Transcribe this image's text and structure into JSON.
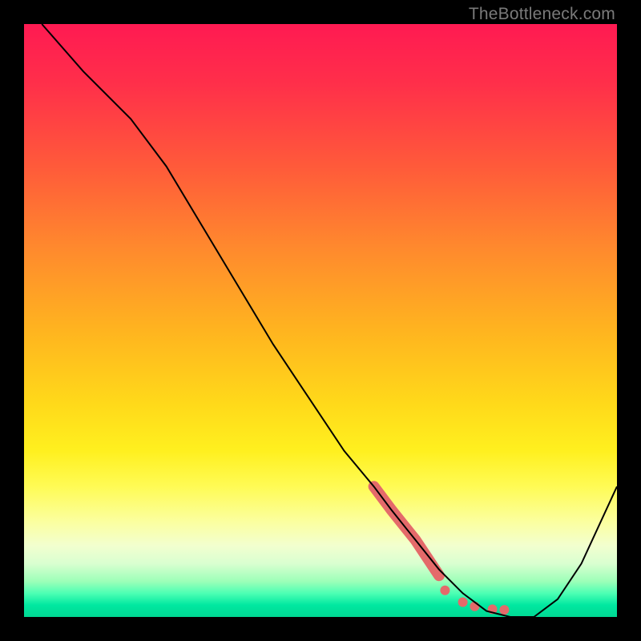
{
  "watermark": "TheBottleneck.com",
  "chart_data": {
    "type": "line",
    "title": "",
    "xlabel": "",
    "ylabel": "",
    "xlim": [
      0,
      100
    ],
    "ylim": [
      0,
      100
    ],
    "grid": false,
    "legend": false,
    "series": [
      {
        "name": "bottleneck-curve",
        "x": [
          3,
          10,
          18,
          24,
          30,
          36,
          42,
          48,
          54,
          59,
          62,
          66,
          70,
          74,
          78,
          82,
          86,
          90,
          94,
          100
        ],
        "y": [
          100,
          92,
          84,
          76,
          66,
          56,
          46,
          37,
          28,
          22,
          18,
          13,
          8,
          4,
          1,
          0,
          0,
          3,
          9,
          22
        ],
        "stroke": "#000000",
        "stroke_width": 2
      }
    ],
    "highlight_segment": {
      "name": "optimal-zone",
      "color": "#e46a6a",
      "thick_width": 14,
      "x": [
        59,
        62,
        66,
        70
      ],
      "y": [
        22,
        18,
        13,
        7
      ]
    },
    "highlight_dots": {
      "name": "optimal-dots",
      "color": "#e46a6a",
      "radius": 6,
      "points": [
        {
          "x": 71,
          "y": 4.5
        },
        {
          "x": 74,
          "y": 2.5
        },
        {
          "x": 76,
          "y": 1.8
        },
        {
          "x": 79,
          "y": 1.3
        },
        {
          "x": 81,
          "y": 1.2
        }
      ]
    }
  }
}
